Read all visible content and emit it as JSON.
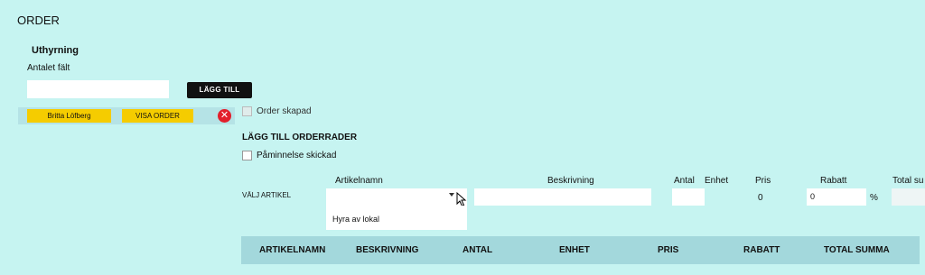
{
  "page": {
    "title": "ORDER"
  },
  "rental": {
    "section_label": "Uthyrning",
    "count_label": "Antalet fält",
    "count_value": "",
    "add_button_label": "LÄGG TILL",
    "entry": {
      "name": "Britta  Löfberg",
      "view_order_label": "VISA ORDER"
    }
  },
  "order": {
    "order_created_label": "Order skapad",
    "order_created_checked": false,
    "add_lines_title": "LÄGG TILL ORDERRADER",
    "reminder_label": "Påminnelse skickad",
    "reminder_checked": false
  },
  "line_form": {
    "choose_article_label": "VÄLJ ARTIKEL",
    "columns": {
      "article_name": "Artikelnamn",
      "description": "Beskrivning",
      "quantity": "Antal",
      "unit": "Enhet",
      "price": "Pris",
      "discount": "Rabatt",
      "total": "Total su"
    },
    "article_selected": "",
    "dropdown_options": [
      "Hyra av lokal"
    ],
    "description_value": "",
    "quantity_value": "",
    "price_value": "0",
    "discount_value": "0",
    "discount_unit": "%"
  },
  "table": {
    "headers": [
      "ARTIKELNAMN",
      "BESKRIVNING",
      "ANTAL",
      "ENHET",
      "PRIS",
      "RABATT",
      "TOTAL SUMMA"
    ]
  },
  "colors": {
    "background": "#c6f4f1",
    "chip": "#f5cc00",
    "primary_button": "#111111",
    "remove": "#e21f2b",
    "table_header": "#a3d8dc"
  },
  "icons": {
    "remove": "close-circle-icon",
    "caret": "caret-down-icon",
    "cursor": "mouse-pointer-icon"
  }
}
